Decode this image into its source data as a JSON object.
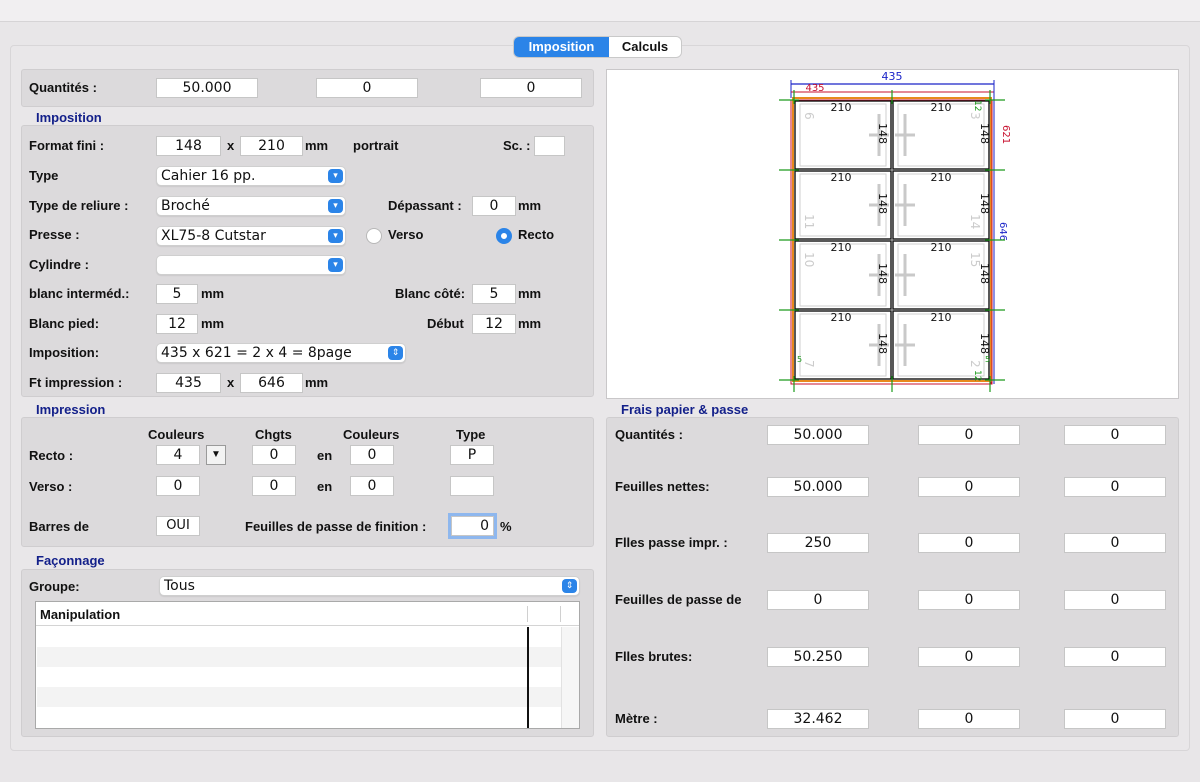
{
  "tabs": {
    "imposition": "Imposition",
    "calculs": "Calculs"
  },
  "quantites": {
    "label": "Quantités :",
    "values": [
      "50.000",
      "0",
      "0"
    ]
  },
  "imposition": {
    "title": "Imposition",
    "format_label": "Format fini :",
    "format_w": "148",
    "x1": "x",
    "format_h": "210",
    "mm": "mm",
    "orientation": "portrait",
    "sc_label": "Sc. :",
    "sc_value": "",
    "type_label": "Type",
    "type_value": "Cahier 16 pp.",
    "reliure_label": "Type de reliure :",
    "reliure_value": "Broché",
    "depassant_label": "Dépassant :",
    "depassant_value": "0",
    "presse_label": "Presse :",
    "presse_value": "XL75-8 Cutstar",
    "verso_label": "Verso",
    "recto_label": "Recto",
    "selected_side": "Recto",
    "cylindre_label": "Cylindre :",
    "cylindre_value": "",
    "blanc_intermed_label": "blanc interméd.:",
    "blanc_intermed_value": "5",
    "blanc_cote_label": "Blanc côté:",
    "blanc_cote_value": "5",
    "blanc_pied_label": "Blanc pied:",
    "blanc_pied_value": "12",
    "debut_label": "Début",
    "debut_value": "12",
    "imposition_label": "Imposition:",
    "imposition_value": "435 x 621 = 2 x 4 = 8page",
    "ft_label": "Ft impression :",
    "ft_w": "435",
    "ft_h": "646"
  },
  "preview": {
    "top_width": "435",
    "inner_width": "435",
    "right_height": "621",
    "outer_height": "646",
    "page_w": "210",
    "page_h": "148",
    "left_numbers": [
      "6",
      "11",
      "10",
      "7"
    ],
    "right_numbers": [
      "3",
      "14",
      "15",
      "2"
    ],
    "green_labels": [
      "12",
      "12",
      "5",
      "5"
    ],
    "colors": {
      "blue": "#1a23c8",
      "red": "#c8102e",
      "green": "#1c9b1c",
      "orange": "#e8891c"
    }
  },
  "impression": {
    "title": "Impression",
    "headers": [
      "Couleurs",
      "Chgts",
      "Couleurs",
      "Type"
    ],
    "recto_label": "Recto :",
    "recto_couleurs": "4",
    "recto_chgts": "0",
    "en1": "en",
    "recto_couleurs2": "0",
    "recto_type": "P",
    "verso_label": "Verso :",
    "verso_couleurs": "0",
    "verso_chgts": "0",
    "en2": "en",
    "verso_couleurs2": "0",
    "verso_type": "",
    "barres_label": "Barres de",
    "barres_value": "OUI",
    "feuilles_finition_label": "Feuilles de passe de finition :",
    "feuilles_finition_value": "0",
    "percent": "%"
  },
  "faconnage": {
    "title": "Façonnage",
    "groupe_label": "Groupe:",
    "groupe_value": "Tous",
    "table_header": "Manipulation"
  },
  "frais": {
    "title": "Frais papier & passe",
    "rows": [
      {
        "label": "Quantités :",
        "values": [
          "50.000",
          "0",
          "0"
        ]
      },
      {
        "label": "Feuilles nettes:",
        "values": [
          "50.000",
          "0",
          "0"
        ]
      },
      {
        "label": "Flles passe impr. :",
        "values": [
          "250",
          "0",
          "0"
        ]
      },
      {
        "label": "Feuilles de passe de",
        "values": [
          "0",
          "0",
          "0"
        ]
      },
      {
        "label": "Flles brutes:",
        "values": [
          "50.250",
          "0",
          "0"
        ]
      },
      {
        "label": "Mètre :",
        "values": [
          "32.462",
          "0",
          "0"
        ]
      }
    ]
  }
}
